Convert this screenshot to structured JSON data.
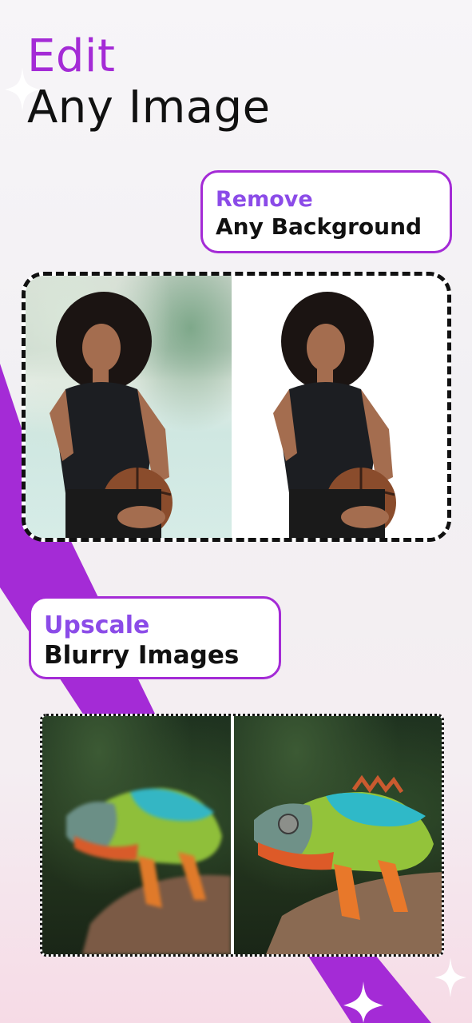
{
  "headline": {
    "line1": "Edit",
    "line2": "Any Image"
  },
  "features": [
    {
      "highlight": "Remove",
      "text": "Any Background"
    },
    {
      "highlight": "Upscale",
      "text": "Blurry Images"
    }
  ],
  "colors": {
    "brand_purple": "#a42bd6",
    "label_purple": "#8b4be8"
  },
  "icons": [
    "sparkle-icon"
  ]
}
